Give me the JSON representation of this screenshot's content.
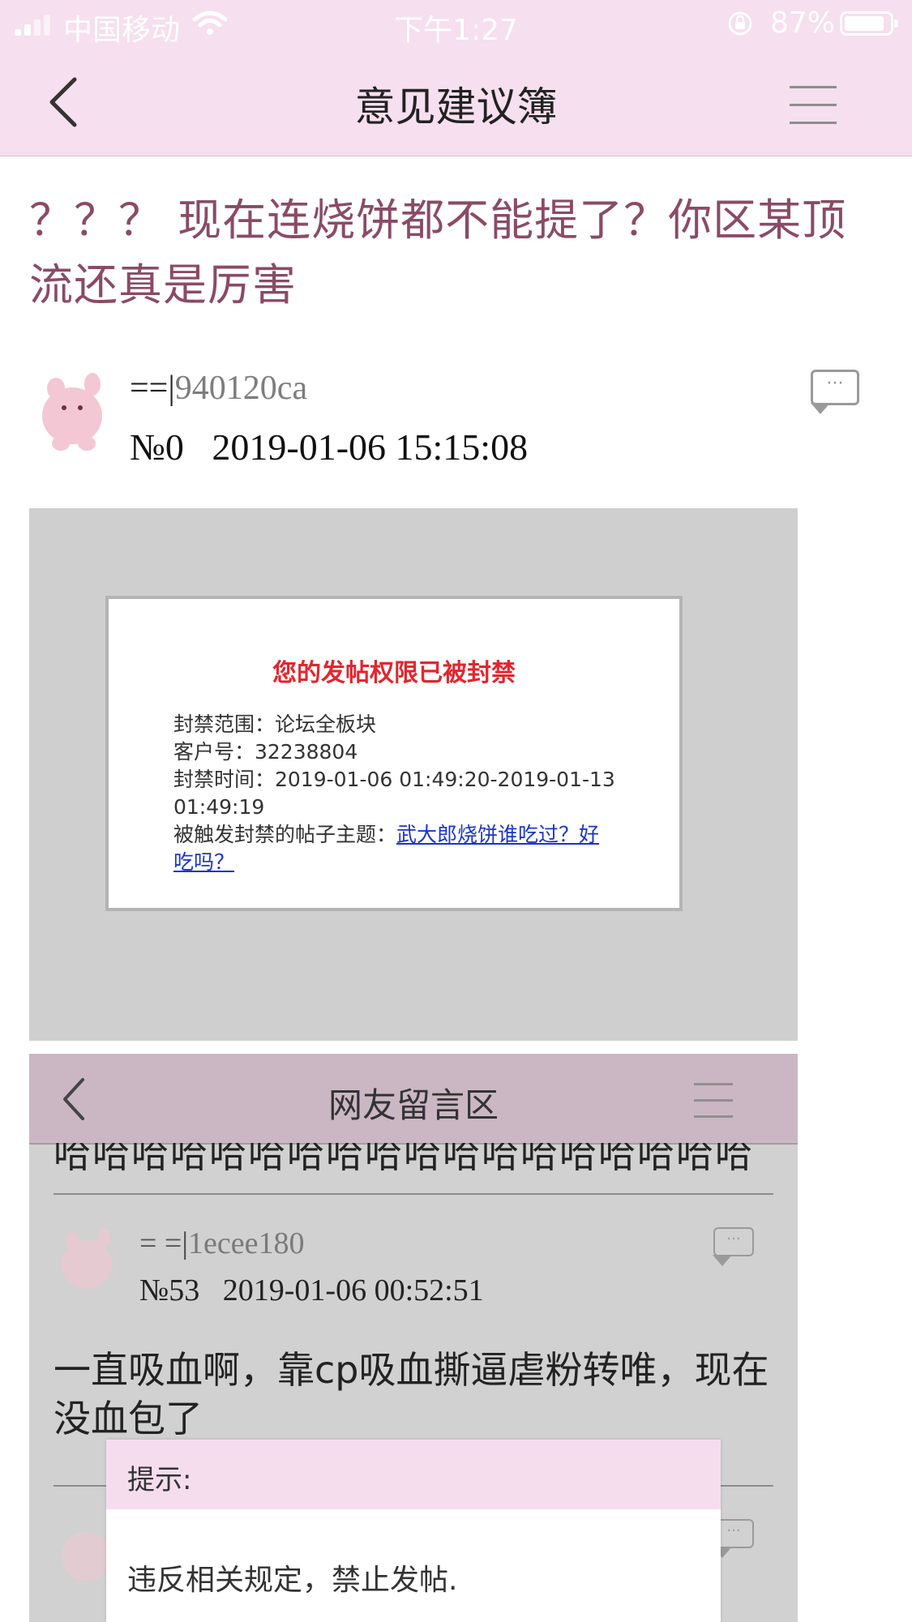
{
  "status_bar": {
    "carrier": "中国移动",
    "time": "下午1:27",
    "battery": "87%",
    "battery_level": 0.87
  },
  "nav": {
    "title": "意见建议簿"
  },
  "post": {
    "title": "？？？ 现在连烧饼都不能提了？你区某顶流还真是厉害",
    "author_prefix": "==",
    "author_id": "940120ca",
    "number_date": "№0   2019-01-06 15:15:08",
    "reply_icon": "comment-bubble-icon"
  },
  "ban_notice": {
    "title": "您的发帖权限已被封禁",
    "lines": [
      "封禁范围：论坛全板块",
      "客户号：32238804",
      "封禁时间：2019-01-06 01:49:20-2019-01-13",
      "01:49:19"
    ],
    "trigger_label": "被触发封禁的帖子主题：",
    "trigger_link_1": "武大郎烧饼谁吃过？好",
    "trigger_link_2": "吃吗？",
    "colors": {
      "title": "#e3262e",
      "link": "#1a35c8"
    }
  },
  "inner_screenshot": {
    "nav_title": "网友留言区",
    "partial_text": "哈哈哈哈哈哈哈哈哈哈哈哈哈哈哈哈哈哈",
    "reply": {
      "author_prefix": "= =",
      "author_id": "1ecee180",
      "number_date": "№53   2019-01-06 00:52:51",
      "text": "一直吸血啊，靠cp吸血撕逼虐粉转唯，现在没血包了"
    }
  },
  "dialog": {
    "title": "提示:",
    "message": "违反相关规定，禁止发帖."
  },
  "colors": {
    "header_bg": "#f6dfee",
    "post_title": "#8a4b66"
  }
}
